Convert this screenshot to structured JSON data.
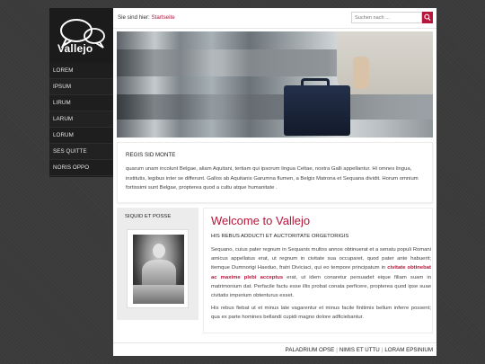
{
  "brand": {
    "name": "Vallejo"
  },
  "nav": {
    "items": [
      "LOREM",
      "IPSUM",
      "LIRUM",
      "LARUM",
      "LORUM",
      "SES QUITTE",
      "NORIS OPPO"
    ]
  },
  "breadcrumb": {
    "prefix": "Sie sind hier:",
    "current": "Startseite"
  },
  "search": {
    "placeholder": "Suchen nach ..."
  },
  "hero": {
    "icon": "briefcase-photo"
  },
  "intro": {
    "title": "REGIS SID MONTE",
    "text": "quarum unam incolunt Belgae, aliam Aquitani, tertiam qui ipsorum lingua Celtae, nostra Galli appellantur. Hi omnes lingua, institutis, legibus inter se differunt. Gallos ab Aquitanis Garumna flumen, a Belgis Matrona et Sequana dividit. Horum omnium fortissimi sunt Belgae, propterea quod a cultu atque humanitate ."
  },
  "sidebox": {
    "title": "SIQUID ET POSSE"
  },
  "welcome": {
    "title": "Welcome to Vallejo",
    "subtitle": "HIS REBUS ADDUCTI ET AUCTORITATE ORGETORIGIS",
    "p1_before": "Sequano, cuius pater regnum in Sequanis multos annos obtinuerat et a senatu populi Romani amicus appellatus erat, ut regnum in civitate sua occuparet, quod pater ante habuerit; itemque Dumnorigi Haeduo, fratri Diviciaci, qui eo tempore principatum in ",
    "p1_highlight": "civitate obtinebat ac maxime plebi acceptus",
    "p1_after": " erat, ut idem conaretur persuadet eique filiam suam in matrimonium dat. Perfacile factu esse illis probat conata perficere, propterea quod ipse suae civitatis imperium obtenturus esset.",
    "p2": "His rebus fiebat ut et minus late vagarentur et minus facile finitimis bellum inferre possent; qua ex parte homines bellandi cupidi magno dolore adficiebantur."
  },
  "footer": {
    "links": [
      "PALADRIUM OPSE",
      "NIMIS ET UTTU",
      "LORAM EPSINIUM"
    ],
    "separator": "|"
  },
  "colors": {
    "accent": "#b5163a",
    "sidebar": "#1b1b1b",
    "background": "#3a3a3a"
  }
}
